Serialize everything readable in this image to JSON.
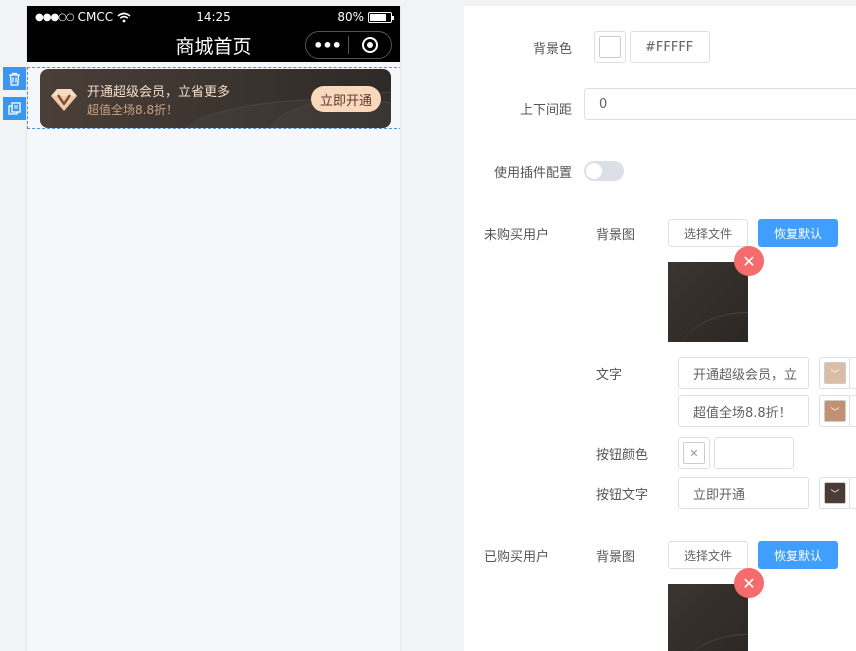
{
  "phone": {
    "status_bar": {
      "carrier": "CMCC",
      "time": "14:25",
      "battery": "80%",
      "battery_level": 0.8
    },
    "nav_title": "商城首页",
    "vip_card": {
      "line1": "开通超级会员，立省更多",
      "line2": "超值全场8.8折！",
      "button": "立即开通"
    }
  },
  "panel": {
    "bg_color": {
      "label": "背景色",
      "value": "#FFFFF",
      "swatch": "#ffffff"
    },
    "margin": {
      "label": "上下间距",
      "value": "0"
    },
    "plugin_config": {
      "label": "使用插件配置",
      "enabled": false
    },
    "unpurchased": {
      "label": "未购买用户",
      "bg_image_label": "背景图",
      "choose_file": "选择文件",
      "restore_default": "恢复默认",
      "text_label": "文字",
      "text1": "开通超级会员，立",
      "text1_color": "#d9bda7",
      "text2": "超值全场8.8折！",
      "text2_color": "#c09273",
      "btn_color_label": "按钮颜色",
      "btn_color_value": "",
      "btn_text_label": "按钮文字",
      "btn_text": "立即开通",
      "btn_text_color": "#4a3c34"
    },
    "purchased": {
      "label": "已购买用户",
      "bg_image_label": "背景图",
      "choose_file": "选择文件",
      "restore_default": "恢复默认"
    }
  }
}
